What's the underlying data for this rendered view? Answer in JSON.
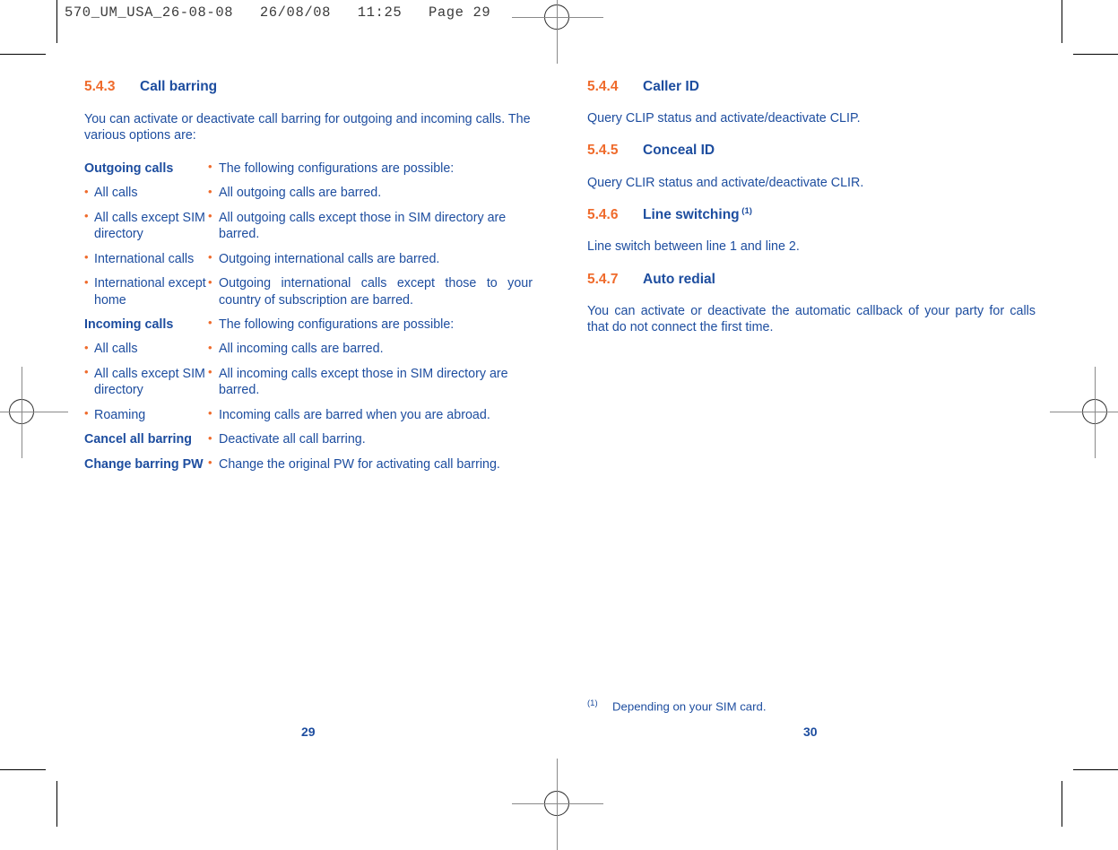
{
  "printer_slug": "570_UM_USA_26-08-08   26/08/08   11:25   Page 29",
  "colors": {
    "heading_number": "#ef6b2c",
    "heading_text": "#1d4d9f",
    "body_text": "#1d4d9f",
    "bullet": "#ef6b2c",
    "crop_mark": "#000000"
  },
  "left_page": {
    "folio": "29",
    "section": {
      "number": "5.4.3",
      "title": "Call barring"
    },
    "intro": "You can activate or deactivate call barring for outgoing and incoming calls. The various options are:",
    "rows": [
      {
        "term": "Outgoing calls",
        "term_style": "bold",
        "desc": "The following configurations are possible:",
        "desc_justify": false
      },
      {
        "term": "All calls",
        "term_style": "bullet",
        "desc": "All outgoing calls are barred.",
        "desc_justify": false
      },
      {
        "term": "All calls except SIM directory",
        "term_style": "bullet",
        "desc": "All outgoing calls except those in SIM directory are barred.",
        "desc_justify": false
      },
      {
        "term": "International calls",
        "term_style": "bullet",
        "desc": "Outgoing international calls are barred.",
        "desc_justify": false
      },
      {
        "term": "International except home",
        "term_style": "bullet",
        "desc": "Outgoing international calls except those to your country of subscription are barred.",
        "desc_justify": true
      },
      {
        "term": "Incoming calls",
        "term_style": "bold",
        "desc": "The following configurations are possible:",
        "desc_justify": false
      },
      {
        "term": "All calls",
        "term_style": "bullet",
        "desc": "All incoming calls are barred.",
        "desc_justify": false
      },
      {
        "term": "All calls except SIM directory",
        "term_style": "bullet",
        "desc": "All incoming calls except those in SIM directory are barred.",
        "desc_justify": false
      },
      {
        "term": "Roaming",
        "term_style": "bullet",
        "desc": "Incoming calls are barred when you are abroad.",
        "desc_justify": false
      },
      {
        "term": "Cancel all barring",
        "term_style": "bold",
        "desc": "Deactivate all call barring.",
        "desc_justify": false
      },
      {
        "term": "Change barring PW",
        "term_style": "bold",
        "desc": "Change the original PW for activating call barring.",
        "desc_justify": false
      }
    ]
  },
  "right_page": {
    "folio": "30",
    "sections": [
      {
        "number": "5.4.4",
        "title": "Caller ID",
        "superscript": "",
        "body": "Query CLIP status and activate/deactivate CLIP.",
        "body_justify": false
      },
      {
        "number": "5.4.5",
        "title": "Conceal ID",
        "superscript": "",
        "body": "Query CLIR status and activate/deactivate CLIR.",
        "body_justify": false
      },
      {
        "number": "5.4.6",
        "title": "Line switching",
        "superscript": "(1)",
        "body": "Line switch between line 1 and line 2.",
        "body_justify": false
      },
      {
        "number": "5.4.7",
        "title": "Auto redial",
        "superscript": "",
        "body": "You can activate or deactivate the automatic callback of your party for calls that do not connect the first time.",
        "body_justify": true
      }
    ],
    "footnote": {
      "mark": "(1)",
      "text": "Depending on your SIM card."
    }
  }
}
